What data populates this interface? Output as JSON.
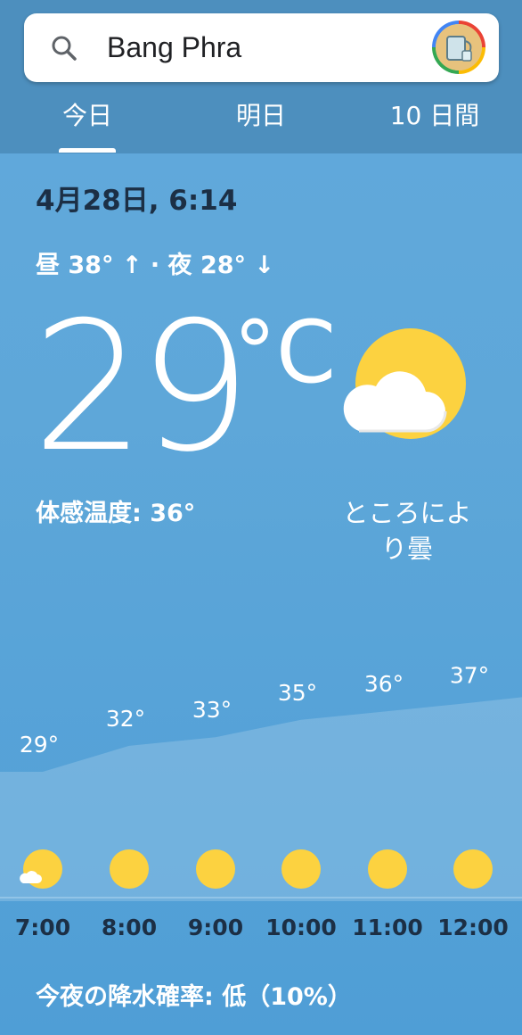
{
  "search": {
    "query": "Bang Phra"
  },
  "tabs": [
    {
      "label": "今日",
      "selected": true
    },
    {
      "label": "明日",
      "selected": false
    },
    {
      "label": "10 日間",
      "selected": false
    }
  ],
  "current": {
    "date_time": "4月28日, 6:14",
    "high_low": "昼 38° ↑ · 夜 28° ↓",
    "temperature": "29",
    "unit": "°C",
    "feels_like_label": "体感温度:",
    "feels_like_value": "36°",
    "condition": "ところにより曇",
    "condition_icon": "partly-cloudy-icon"
  },
  "hourly": [
    {
      "time": "7:00",
      "temp_label": "29°",
      "temp": 29,
      "icon": "partly-cloudy-icon"
    },
    {
      "time": "8:00",
      "temp_label": "32°",
      "temp": 32,
      "icon": "sun-icon"
    },
    {
      "time": "9:00",
      "temp_label": "33°",
      "temp": 33,
      "icon": "sun-icon"
    },
    {
      "time": "10:00",
      "temp_label": "35°",
      "temp": 35,
      "icon": "sun-icon"
    },
    {
      "time": "11:00",
      "temp_label": "36°",
      "temp": 36,
      "icon": "sun-icon"
    },
    {
      "time": "12:00",
      "temp_label": "37°",
      "temp": 37,
      "icon": "sun-icon"
    }
  ],
  "precipitation": {
    "text": "今夜の降水確率: 低（10%）"
  },
  "colors": {
    "sun": "#fcd240",
    "header": "#4d8fbe",
    "background": "#5ea7d9",
    "date_text": "#1c2f45"
  }
}
